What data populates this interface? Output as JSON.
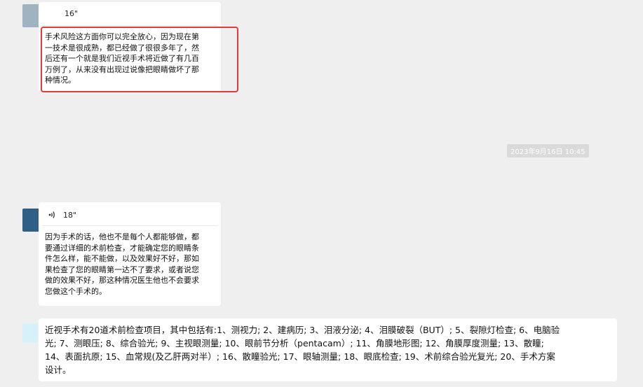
{
  "colors": {
    "background": "#efefef",
    "bubble": "#ffffff",
    "highlight": "#e53935",
    "avatar_1": "#9fb3c0",
    "avatar_2": "#2f5f86",
    "avatar_3": "#d7f1fb"
  },
  "messages": [
    {
      "voice_duration": "16\"",
      "text": "手术风险这方面你可以完全放心，因为现在第\n一技术是很成熟，都已经做了很很多年了，然\n后还有一个就是我们近视手术将近做了有几百\n万例了，从来没有出现过说像把眼睛做坏了那\n种情况。",
      "highlighted": true
    },
    {
      "voice_duration": "18\"",
      "voice_icon": "voice-wave-icon",
      "text": "因为手术的话，他也不是每个人都能够做，都\n要通过详细的术前检查，才能确定您的眼睛条\n件怎么样，能不能做，以及效果好不好，那如\n果检查了您的眼睛第一达不了要求，或者说您\n做的效果不好，那这种情况医生他也不会要求\n您做这个手术的。"
    },
    {
      "text": "近视手术有20道术前检查项目，其中包括有:1、测视力; 2、建病历; 3、泪液分泌; 4、泪膜破裂（BUT）; 5、裂隙灯检查; 6、电脑验\n光; 7、测眼压; 8、综合验光; 9、主视眼测量; 10、眼前节分析（pentacam）; 11、角膜地形图; 12、角膜厚度测量; 13、散瞳;\n14、表面抗原; 15、血常规(及乙肝两对半）; 16、散瞳验光; 17、眼轴测量; 18、眼底检查; 19、术前综合验光复光; 20、手术方案\n设计。"
    }
  ],
  "timestamp": "2023年9月16日 10:45"
}
